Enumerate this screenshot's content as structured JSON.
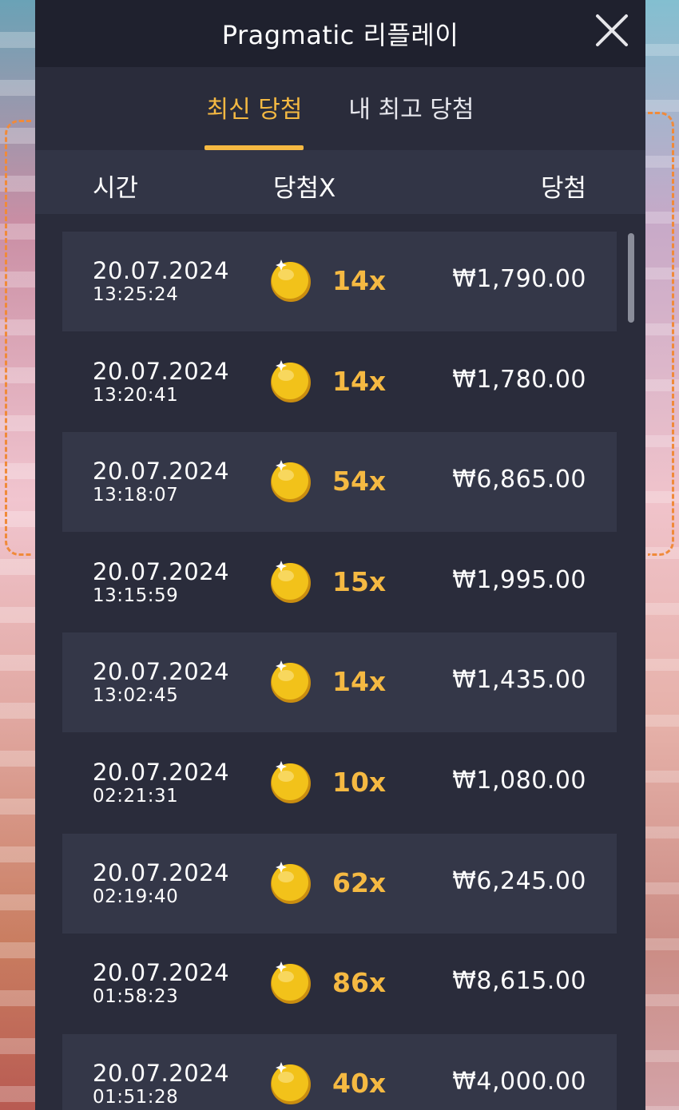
{
  "header": {
    "title": "Pragmatic 리플레이",
    "close_icon": "close-icon"
  },
  "tabs": [
    {
      "label": "최신 당첨",
      "active": true
    },
    {
      "label": "내 최고 당첨",
      "active": false
    }
  ],
  "columns": {
    "time": "시간",
    "multiplier": "당첨X",
    "win": "당첨"
  },
  "rows": [
    {
      "date": "20.07.2024",
      "time": "13:25:24",
      "multiplier": "14x",
      "amount": "₩1,790.00"
    },
    {
      "date": "20.07.2024",
      "time": "13:20:41",
      "multiplier": "14x",
      "amount": "₩1,780.00"
    },
    {
      "date": "20.07.2024",
      "time": "13:18:07",
      "multiplier": "54x",
      "amount": "₩6,865.00"
    },
    {
      "date": "20.07.2024",
      "time": "13:15:59",
      "multiplier": "15x",
      "amount": "₩1,995.00"
    },
    {
      "date": "20.07.2024",
      "time": "13:02:45",
      "multiplier": "14x",
      "amount": "₩1,435.00"
    },
    {
      "date": "20.07.2024",
      "time": "02:21:31",
      "multiplier": "10x",
      "amount": "₩1,080.00"
    },
    {
      "date": "20.07.2024",
      "time": "02:19:40",
      "multiplier": "62x",
      "amount": "₩6,245.00"
    },
    {
      "date": "20.07.2024",
      "time": "01:58:23",
      "multiplier": "86x",
      "amount": "₩8,615.00"
    },
    {
      "date": "20.07.2024",
      "time": "01:51:28",
      "multiplier": "40x",
      "amount": "₩4,000.00"
    }
  ],
  "colors": {
    "accent": "#f5b942",
    "panel": "#2a2c3b",
    "titlebar": "#1f212e"
  }
}
